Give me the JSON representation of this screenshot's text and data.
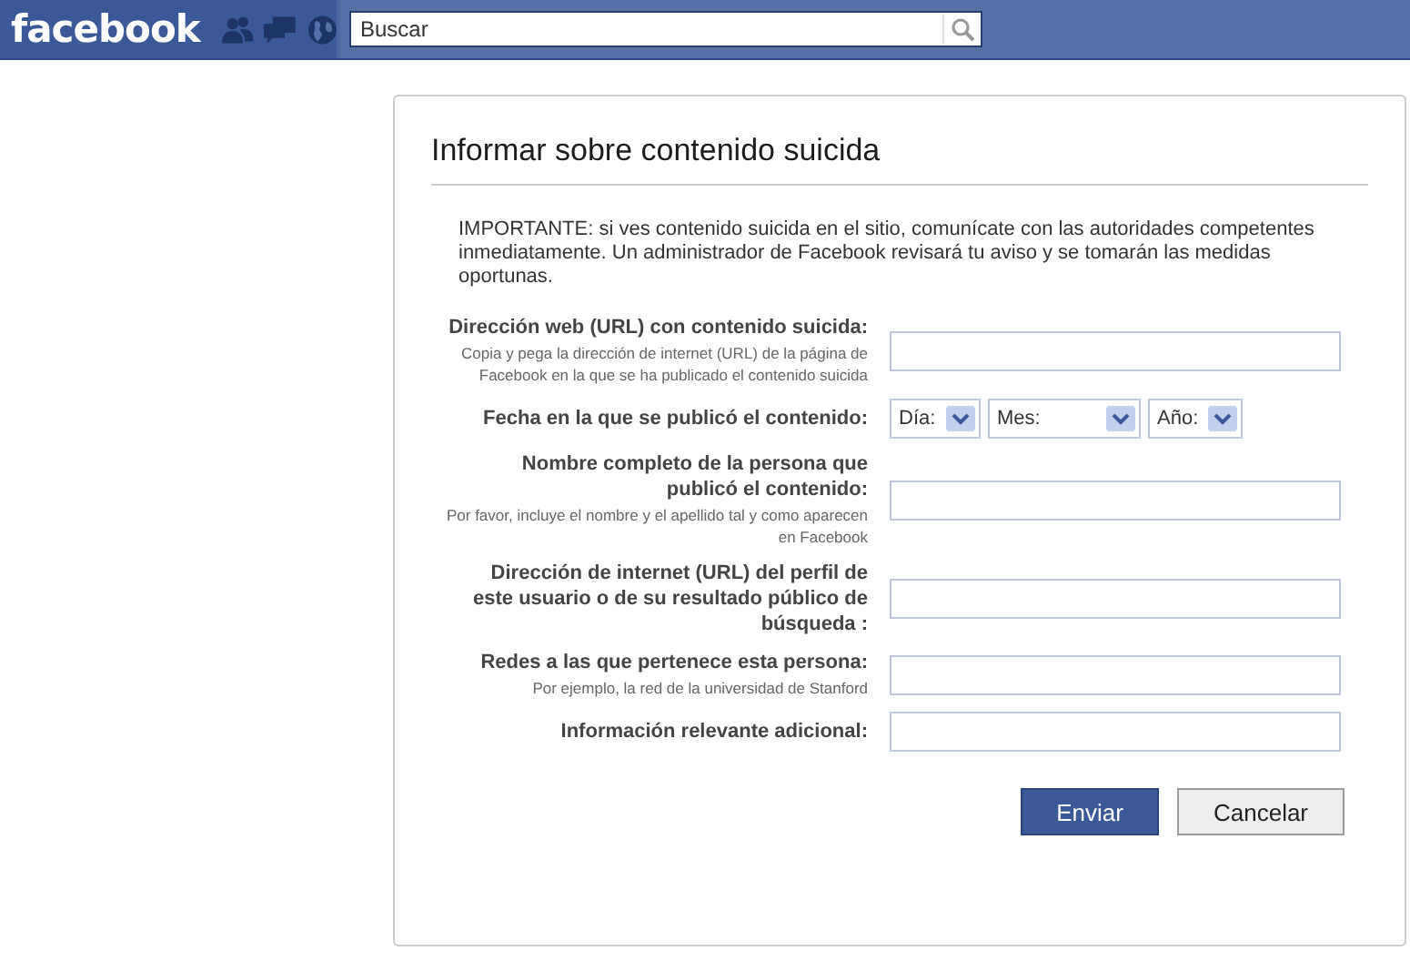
{
  "header": {
    "logo": "facebook",
    "search": {
      "placeholder": "Buscar"
    }
  },
  "dialog": {
    "title": "Informar sobre contenido suicida",
    "notice": "IMPORTANTE: si ves contenido suicida en el sitio, comunícate con las autoridades competentes inmediatamente. Un administrador de Facebook revisará tu aviso y se tomarán las medidas oportunas.",
    "fields": [
      {
        "kind": "text",
        "label": "Dirección web (URL) con contenido suicida:",
        "hint": "Copia y pega la dirección de internet (URL) de la página de Facebook en la que se ha publicado el contenido suicida"
      },
      {
        "kind": "date",
        "label": "Fecha en la que se publicó el contenido:",
        "selects": [
          "Día:",
          "Mes:",
          "Año:"
        ]
      },
      {
        "kind": "text",
        "label": "Nombre completo de la persona que publicó el contenido:",
        "hint": "Por favor, incluye el nombre y el apellido tal y como aparecen en Facebook"
      },
      {
        "kind": "text",
        "label": "Dirección de internet (URL) del perfil de este usuario o de su resultado público de búsqueda :"
      },
      {
        "kind": "text",
        "label": "Redes a las que pertenece esta persona:",
        "hint": "Por ejemplo, la red de la universidad de Stanford"
      },
      {
        "kind": "text",
        "label": "Información relevante adicional:"
      }
    ],
    "buttons": [
      {
        "kind": "primary",
        "label": "Enviar"
      },
      {
        "kind": "secondary",
        "label": "Cancelar"
      }
    ]
  }
}
